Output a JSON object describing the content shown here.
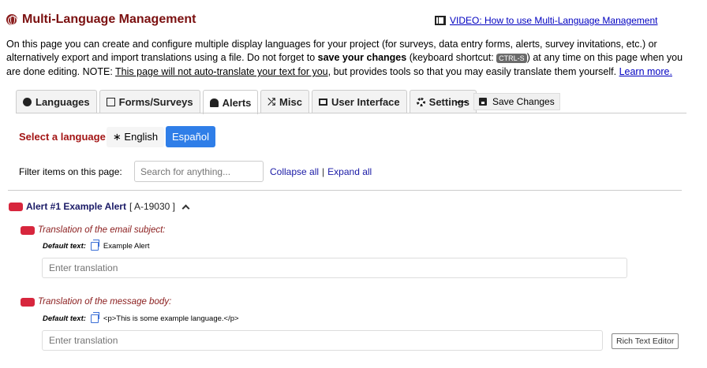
{
  "header": {
    "title": "Multi-Language Management",
    "video_link": "VIDEO: How to use Multi-Language Management"
  },
  "intro": {
    "part1": "On this page you can create and configure multiple display languages for your project (for surveys, data entry forms, alerts, survey invitations, etc.) or alternatively export and import translations using a file. Do not forget to ",
    "bold": "save your changes",
    "part2": " (keyboard shortcut: ",
    "kbd": "CTRL-S",
    "part3": ") at any time on this page when you are done editing. NOTE: ",
    "note_link": "This page will not auto-translate your text for you",
    "part4": ", but provides tools so that you may easily translate them yourself. ",
    "learn_more": "Learn more."
  },
  "tabs": [
    {
      "label": "Languages",
      "icon": "globe-icon"
    },
    {
      "label": "Forms/Surveys",
      "icon": "table-icon"
    },
    {
      "label": "Alerts",
      "icon": "bell-icon",
      "active": true
    },
    {
      "label": "Misc",
      "icon": "shuffle-icon"
    },
    {
      "label": "User Interface",
      "icon": "monitor-icon"
    },
    {
      "label": "Settings",
      "icon": "gear-icon"
    }
  ],
  "toolbar": {
    "save_label": "Save Changes"
  },
  "language_select": {
    "label": "Select a language:",
    "options": [
      {
        "label": "∗ English",
        "selected": false
      },
      {
        "label": "Español",
        "selected": true
      }
    ],
    "accent_color": "#2f7ee8"
  },
  "filter": {
    "label": "Filter items on this page:",
    "placeholder": "Search for anything...",
    "collapse_all": "Collapse all",
    "separator": "|",
    "expand_all": "Expand all"
  },
  "alert": {
    "title": "Alert #1 Example Alert",
    "id": "[ A-19030 ]",
    "sections": [
      {
        "title": "Translation of the email subject:",
        "default_label": "Default text:",
        "default_value": "Example Alert",
        "placeholder": "Enter translation"
      },
      {
        "title": "Translation of the message body:",
        "default_label": "Default text:",
        "default_value": "<p>This is some example language.</p>",
        "placeholder": "Enter translation",
        "rich_text_button": "Rich Text Editor"
      }
    ]
  },
  "colors": {
    "title": "#7b1010",
    "badge": "#d7263d",
    "link": "#0000c0"
  }
}
